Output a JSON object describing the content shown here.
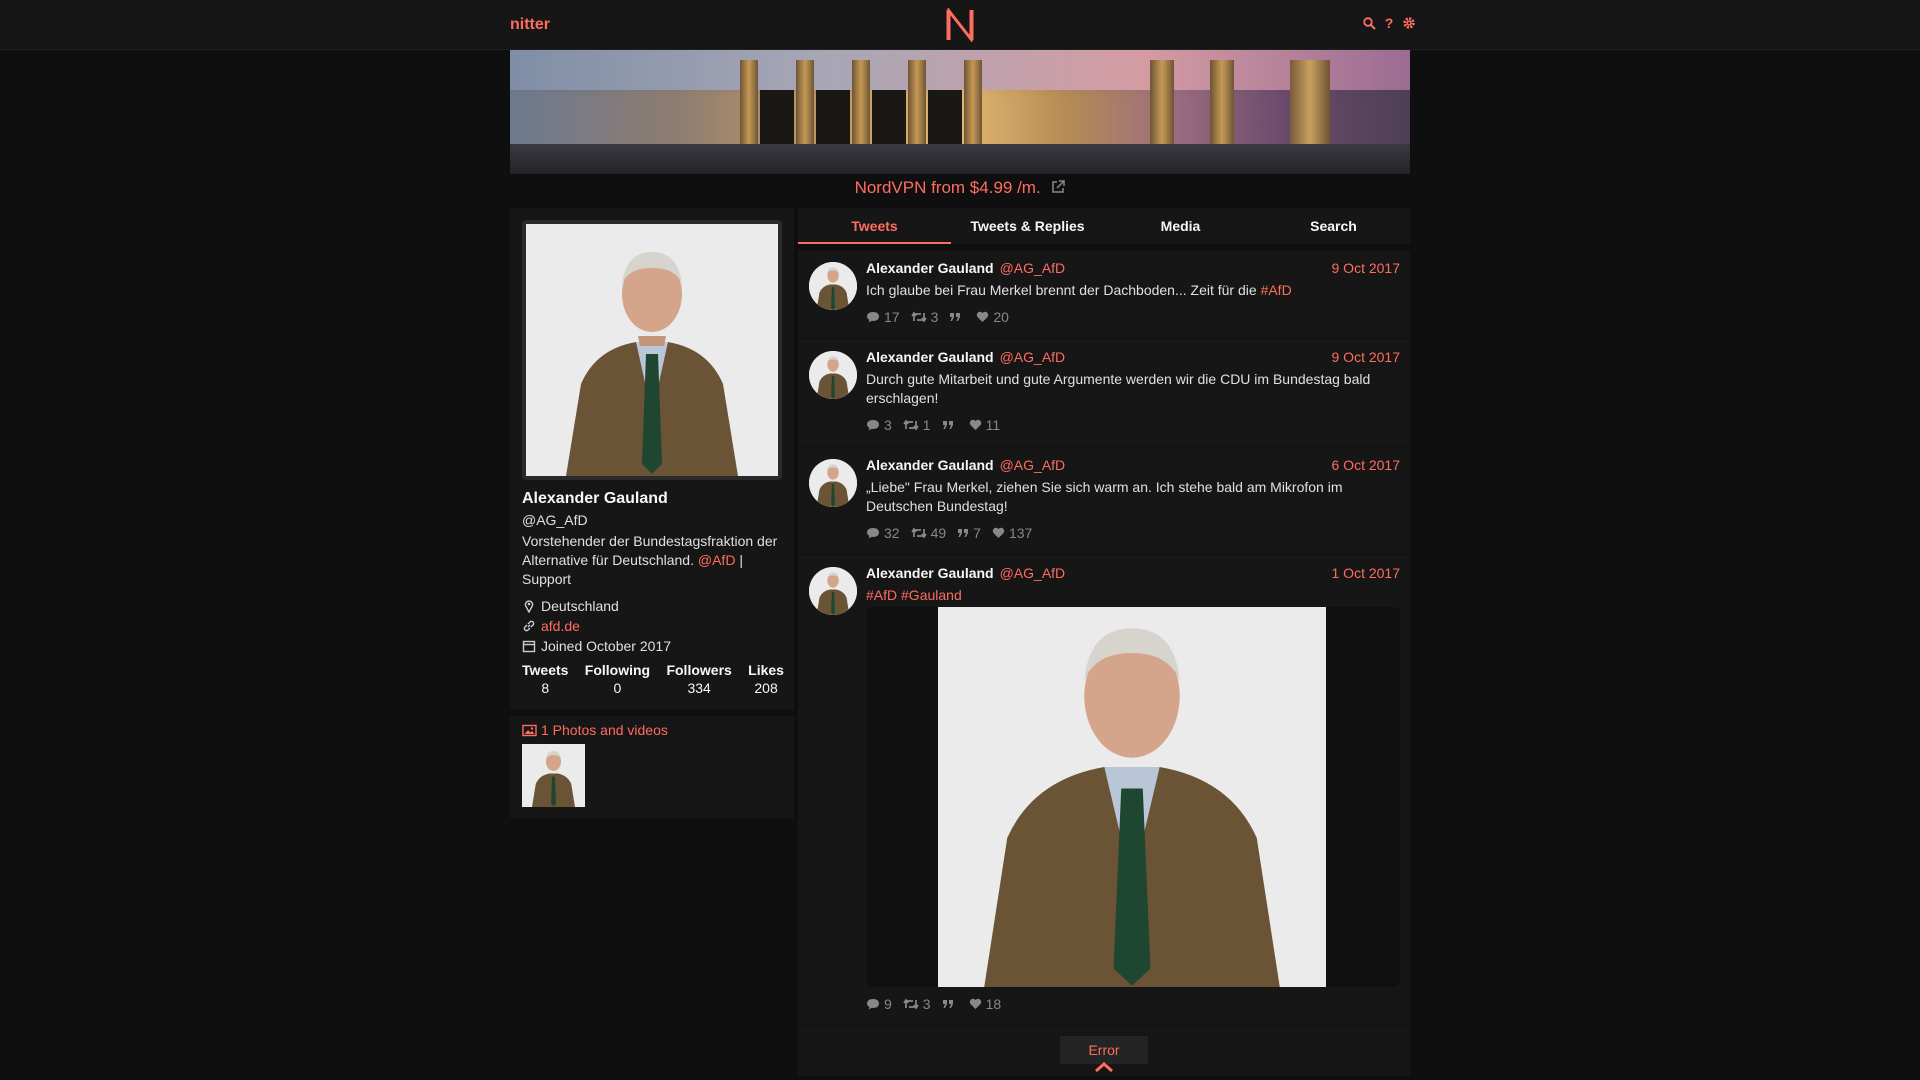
{
  "nav": {
    "brand": "nitter",
    "icons": [
      "search-icon",
      "help-icon",
      "gear-icon"
    ]
  },
  "ad": {
    "text": "NordVPN from $4.99 /m."
  },
  "profile": {
    "name": "Alexander Gauland",
    "handle": "@AG_AfD",
    "bio_pre": "Vorstehender der Bundestagsfraktion der Alternative für Deutschland. ",
    "bio_link": "@AfD",
    "bio_post": " | Support",
    "location": "Deutschland",
    "website": "afd.de",
    "joined": "Joined October 2017",
    "stats": [
      {
        "label": "Tweets",
        "value": "8"
      },
      {
        "label": "Following",
        "value": "0"
      },
      {
        "label": "Followers",
        "value": "334"
      },
      {
        "label": "Likes",
        "value": "208"
      }
    ]
  },
  "photos": {
    "label": "1 Photos and videos"
  },
  "tabs": [
    "Tweets",
    "Tweets & Replies",
    "Media",
    "Search"
  ],
  "tweets": [
    {
      "name": "Alexander Gauland",
      "handle": "@AG_AfD",
      "date": "9 Oct 2017",
      "text": "Ich glaube bei Frau Merkel brennt der Dachboden... Zeit für die ",
      "tag": "#AfD",
      "replies": "17",
      "retweets": "3",
      "quotes": "",
      "likes": "20"
    },
    {
      "name": "Alexander Gauland",
      "handle": "@AG_AfD",
      "date": "9 Oct 2017",
      "text": "Durch gute Mitarbeit und gute Argumente werden wir die CDU im Bundestag bald erschlagen!",
      "tag": "",
      "replies": "3",
      "retweets": "1",
      "quotes": "",
      "likes": "11"
    },
    {
      "name": "Alexander Gauland",
      "handle": "@AG_AfD",
      "date": "6 Oct 2017",
      "text": "„Liebe\" Frau Merkel, ziehen Sie sich warm an. Ich stehe bald am Mikrofon im Deutschen Bundestag!",
      "tag": "",
      "replies": "32",
      "retweets": "49",
      "quotes": "7",
      "likes": "137"
    },
    {
      "name": "Alexander Gauland",
      "handle": "@AG_AfD",
      "date": "1 Oct 2017",
      "text": "",
      "tag": "#AfD #Gauland",
      "replies": "9",
      "retweets": "3",
      "quotes": "",
      "likes": "18"
    }
  ],
  "more": {
    "error_label": "Error"
  },
  "colors": {
    "accent": "#ff6c60",
    "bg": "#0f0f0f",
    "panel": "#161616"
  }
}
